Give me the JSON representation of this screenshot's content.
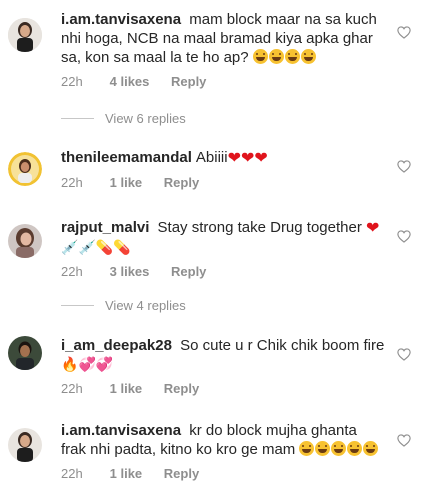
{
  "comments": [
    {
      "username": "i.am.tanvisaxena",
      "text": "mam block maar na sa kuch nhi hoga, NCB na maal bramad kiya apka ghar sa, kon sa maal la te ho ap?",
      "emojis": [
        "laugh",
        "laugh",
        "laugh",
        "laugh"
      ],
      "time": "22h",
      "likes": "4 likes",
      "reply": "Reply"
    },
    {
      "username": "thenileemamandal",
      "text": "Abiiii",
      "emojis": [
        "heart",
        "heart",
        "heart"
      ],
      "time": "22h",
      "likes": "1 like",
      "reply": "Reply"
    },
    {
      "username": "rajput_malvi",
      "text": "Stay strong take Drug together",
      "emojis": [
        "heart",
        "syringe",
        "syringe",
        "pill",
        "pill"
      ],
      "time": "22h",
      "likes": "3 likes",
      "reply": "Reply"
    },
    {
      "username": "i_am_deepak28",
      "text": "So cute u r Chik chik boom fire",
      "emojis": [
        "fire",
        "sparkle-heart",
        "sparkle-heart"
      ],
      "time": "22h",
      "likes": "1 like",
      "reply": "Reply"
    },
    {
      "username": "i.am.tanvisaxena",
      "text": "kr do block mujha ghanta frak nhi padta, kitno ko kro ge mam",
      "emojis": [
        "laugh",
        "laugh",
        "laugh",
        "laugh",
        "laugh"
      ],
      "time": "22h",
      "likes": "1 like",
      "reply": "Reply"
    }
  ],
  "view_replies": [
    {
      "label": "View 6 replies"
    },
    {
      "label": "View 4 replies"
    }
  ],
  "icons": {
    "like": "heart-outline-icon"
  },
  "colors": {
    "text": "#262626",
    "secondary": "#8e8e8e",
    "divider": "#c7c7c7",
    "heart_red": "#e0141c"
  }
}
